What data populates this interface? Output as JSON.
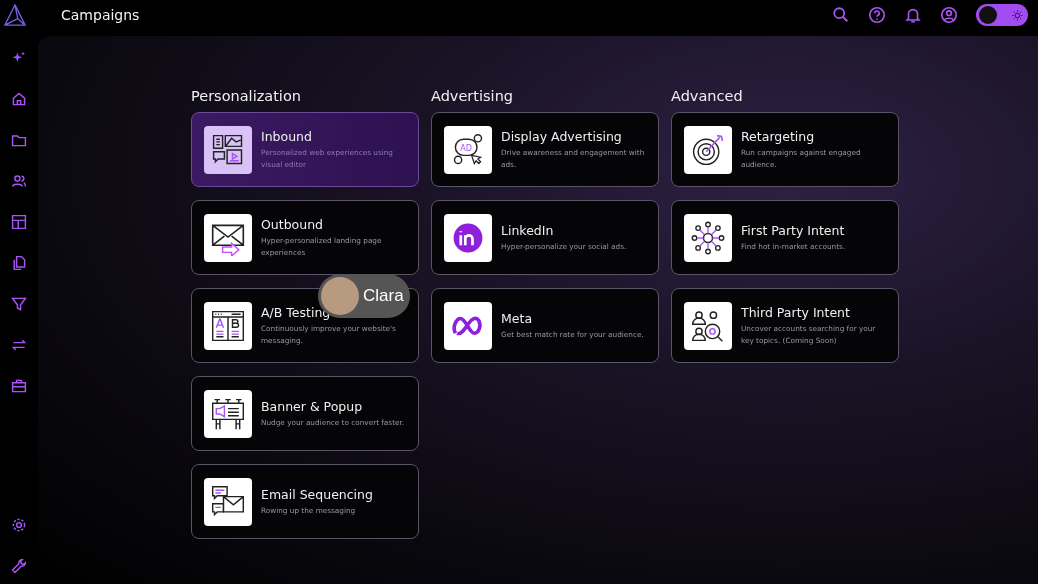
{
  "header": {
    "title": "Campaigns",
    "theme_toggle": {
      "on": false
    }
  },
  "columns": [
    {
      "title": "Personalization",
      "cards": [
        {
          "title": "Inbound",
          "description": "Personalized web experiences using visual editor",
          "selected": true
        },
        {
          "title": "Outbound",
          "description": "Hyper-personalized landing page experiences",
          "selected": false
        },
        {
          "title": "A/B Testing",
          "description": "Continuously improve your website's messaging.",
          "selected": false
        },
        {
          "title": "Banner & Popup",
          "description": "Nudge your audience to convert faster.",
          "selected": false
        },
        {
          "title": "Email Sequencing",
          "description": "Rowing up the messaging",
          "selected": false
        }
      ]
    },
    {
      "title": "Advertising",
      "cards": [
        {
          "title": "Display Advertising",
          "description": "Drive awareness and engagement with ads.",
          "icon_text": "AD",
          "selected": false
        },
        {
          "title": "LinkedIn",
          "description": "Hyper-personalize your social ads.",
          "selected": false
        },
        {
          "title": "Meta",
          "description": "Get best match rate for your audience.",
          "selected": false
        }
      ]
    },
    {
      "title": "Advanced",
      "cards": [
        {
          "title": "Retargeting",
          "description": "Run campaigns against engaged audience.",
          "selected": false
        },
        {
          "title": "First Party Intent",
          "description": "Find hot in-market accounts.",
          "selected": false
        },
        {
          "title": "Third Party Intent",
          "description": "Uncover accounts searching for your key topics. (Coming Soon)",
          "selected": false
        }
      ]
    }
  ],
  "presenter": {
    "name": "Clara"
  }
}
